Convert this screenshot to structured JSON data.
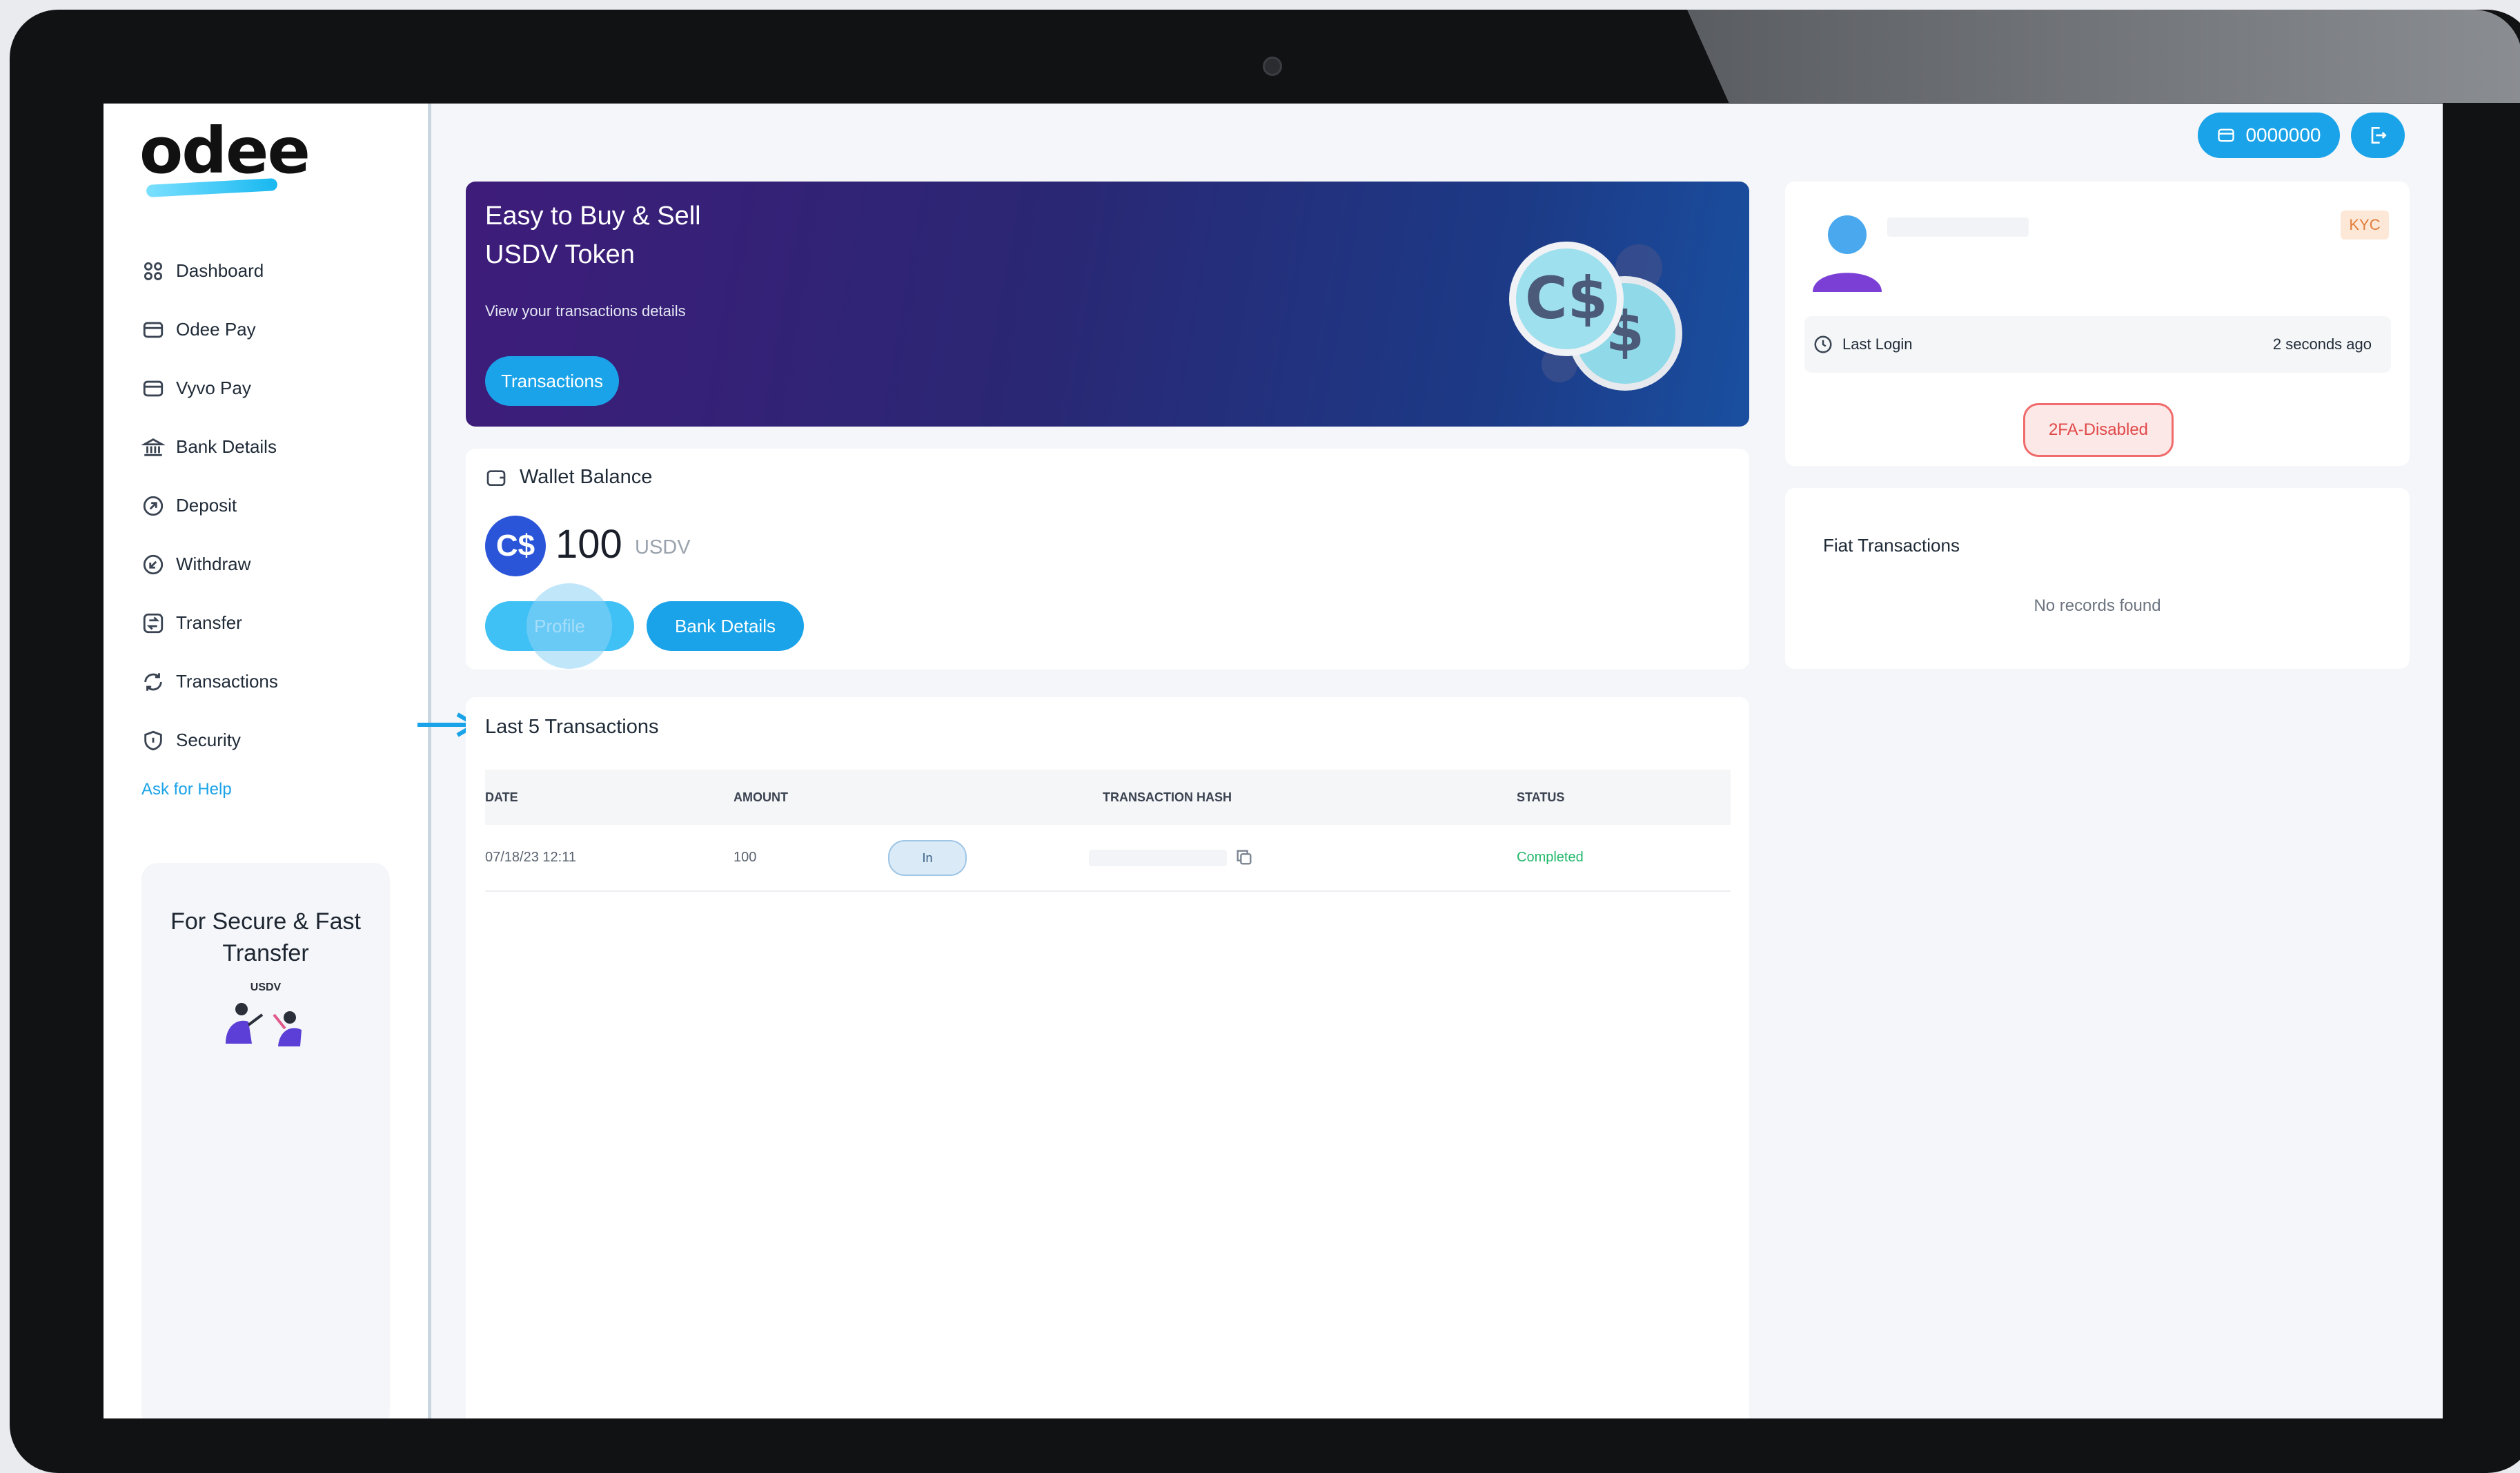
{
  "brand": {
    "name": "odee"
  },
  "sidebar": {
    "items": [
      {
        "label": "Dashboard",
        "icon": "grid-icon"
      },
      {
        "label": "Odee Pay",
        "icon": "card-icon"
      },
      {
        "label": "Vyvo Pay",
        "icon": "card-icon"
      },
      {
        "label": "Bank Details",
        "icon": "bank-icon"
      },
      {
        "label": "Deposit",
        "icon": "deposit-icon"
      },
      {
        "label": "Withdraw",
        "icon": "withdraw-icon"
      },
      {
        "label": "Transfer",
        "icon": "transfer-icon"
      },
      {
        "label": "Transactions",
        "icon": "refresh-icon"
      },
      {
        "label": "Security",
        "icon": "shield-icon"
      }
    ],
    "help_link": "Ask for Help",
    "promo": {
      "title": "For Secure & Fast Transfer",
      "label": "USDV"
    }
  },
  "header": {
    "account_number": "0000000"
  },
  "banner": {
    "title_line1": "Easy to Buy & Sell",
    "title_line2": "USDV Token",
    "subtitle": "View your transactions details",
    "button": "Transactions"
  },
  "wallet": {
    "title": "Wallet Balance",
    "currency_symbol": "C$",
    "amount": "100",
    "unit": "USDV",
    "profile_button": "Profile",
    "bank_button": "Bank Details"
  },
  "transactions": {
    "title": "Last 5 Transactions",
    "columns": [
      "DATE",
      "AMOUNT",
      "TRANSACTION HASH",
      "STATUS"
    ],
    "rows": [
      {
        "date": "07/18/23 12:11",
        "amount": "100",
        "direction": "In",
        "status": "Completed"
      }
    ]
  },
  "profile": {
    "kyc_badge": "KYC",
    "last_login_label": "Last Login",
    "last_login_value": "2 seconds ago",
    "twofa": "2FA-Disabled"
  },
  "fiat": {
    "title": "Fiat Transactions",
    "empty": "No records found"
  },
  "colors": {
    "accent": "#1aa3e8",
    "success": "#21b86a",
    "danger": "#e04848",
    "kyc": "#e07d3a"
  }
}
